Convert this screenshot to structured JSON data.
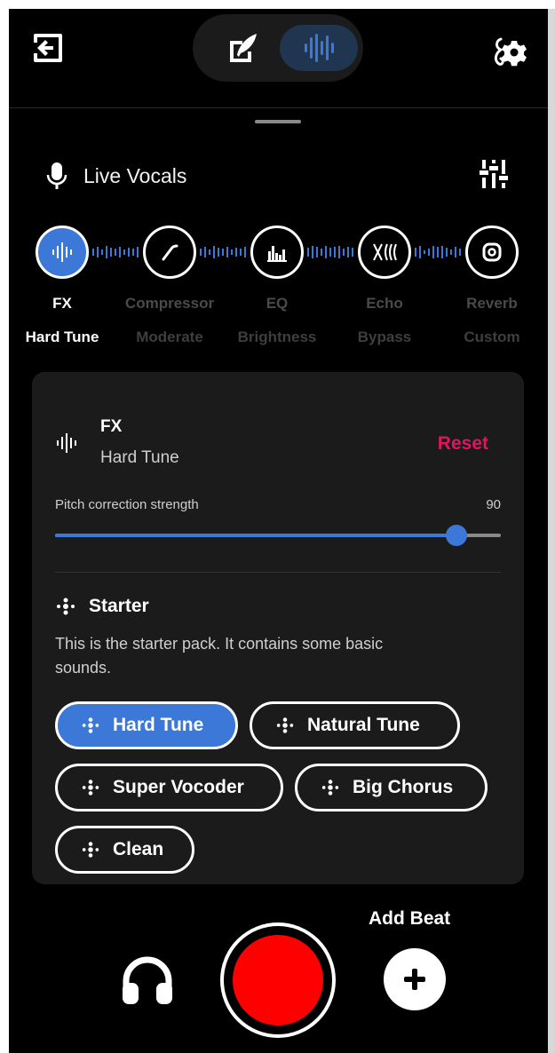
{
  "colors": {
    "background": "#000000",
    "card": "#1b1b1b",
    "accent": "#3b78d8",
    "reset": "#e0155e",
    "record": "#ff0000"
  },
  "header": {
    "exit_icon": "exit-icon",
    "modes": [
      {
        "name": "lyrics",
        "icon": "quill-edit-icon",
        "active": false
      },
      {
        "name": "audio",
        "icon": "waveform-icon",
        "active": true
      }
    ],
    "settings_icon": "music-settings-icon"
  },
  "live": {
    "title": "Live Vocals",
    "mic_icon": "microphone-icon",
    "mixer_icon": "mixer-sliders-icon"
  },
  "chain": [
    {
      "label": "FX",
      "sub": "Hard Tune",
      "icon": "waveform-icon",
      "active": true
    },
    {
      "label": "Compressor",
      "sub": "Moderate",
      "icon": "compressor-curve-icon",
      "active": false
    },
    {
      "label": "EQ",
      "sub": "Brightness",
      "icon": "equalizer-icon",
      "active": false
    },
    {
      "label": "Echo",
      "sub": "Bypass",
      "icon": "echo-icon",
      "active": false
    },
    {
      "label": "Reverb",
      "sub": "Custom",
      "icon": "reverb-icon",
      "active": false
    }
  ],
  "card": {
    "title": "FX",
    "subtitle": "Hard Tune",
    "reset_label": "Reset",
    "param": {
      "label": "Pitch correction strength",
      "value": "90",
      "fraction": 0.9
    },
    "pack": {
      "title": "Starter",
      "description": "This is the starter pack. It contains some basic sounds."
    },
    "presets": [
      {
        "label": "Hard Tune",
        "active": true
      },
      {
        "label": "Natural Tune",
        "active": false
      },
      {
        "label": "Super Vocoder",
        "active": false
      },
      {
        "label": "Big Chorus",
        "active": false
      },
      {
        "label": "Clean",
        "active": false
      }
    ]
  },
  "footer": {
    "add_beat_label": "Add Beat",
    "headphones_icon": "headphones-icon",
    "record_icon": "record-button",
    "add_icon": "plus-icon"
  }
}
